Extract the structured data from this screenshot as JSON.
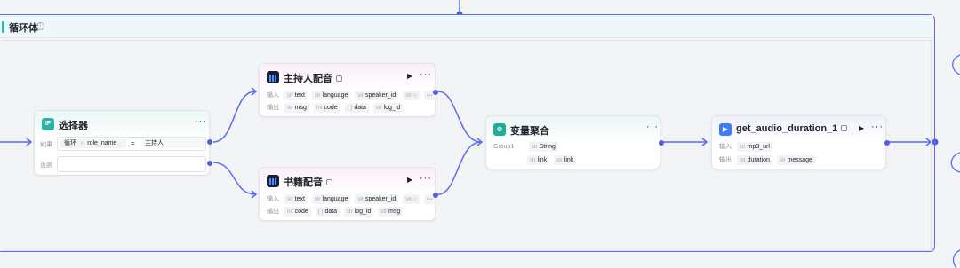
{
  "loop": {
    "title": "循环体",
    "info_glyph": "i"
  },
  "selector": {
    "title": "选择器",
    "icon_text": "IF",
    "if_label": "如果",
    "path_root": "循环",
    "path_sep": "›",
    "path_field": "role_name",
    "operator": "=",
    "value": "主持人",
    "else_label": "否则",
    "menu": "···"
  },
  "host_voice": {
    "title": "主持人配音",
    "menu": "···",
    "play": "▶",
    "input_label": "输入",
    "output_label": "输出",
    "inputs": [
      {
        "type": "str",
        "name": "text"
      },
      {
        "type": "str",
        "name": "language"
      },
      {
        "type": "str",
        "name": "speaker_id"
      },
      {
        "type": "str",
        "name": "u"
      }
    ],
    "input_more": "···",
    "outputs": [
      {
        "type": "str",
        "name": "msg"
      },
      {
        "type": "Int",
        "name": "code"
      },
      {
        "type": "{ }",
        "name": "data"
      },
      {
        "type": "str",
        "name": "log_id"
      }
    ]
  },
  "book_voice": {
    "title": "书籍配音",
    "menu": "···",
    "play": "▶",
    "input_label": "输入",
    "output_label": "输出",
    "inputs": [
      {
        "type": "str",
        "name": "text"
      },
      {
        "type": "str",
        "name": "language"
      },
      {
        "type": "str",
        "name": "speaker_id"
      },
      {
        "type": "str",
        "name": "u"
      }
    ],
    "input_more": "···",
    "outputs": [
      {
        "type": "Int",
        "name": "code"
      },
      {
        "type": "{ }",
        "name": "data"
      },
      {
        "type": "str",
        "name": "log_id"
      },
      {
        "type": "str",
        "name": "msg"
      }
    ]
  },
  "aggregator": {
    "title": "变量聚合",
    "menu": "···",
    "group_label": "Group1",
    "group_type": "str",
    "group_value": "String",
    "links": [
      {
        "type": "str",
        "name": "link"
      },
      {
        "type": "str",
        "name": "link"
      }
    ]
  },
  "audio_duration": {
    "title": "get_audio_duration_1",
    "menu": "···",
    "play": "▶",
    "input_label": "输入",
    "output_label": "输出",
    "inputs": [
      {
        "type": "str",
        "name": "mp3_url"
      }
    ],
    "outputs": [
      {
        "type": "Int",
        "name": "duration"
      },
      {
        "type": "str",
        "name": "message"
      }
    ]
  },
  "colors": {
    "wire": "#5b6cf0",
    "port": "#4e5fe0",
    "loop_accent": "#2bb5a4"
  }
}
